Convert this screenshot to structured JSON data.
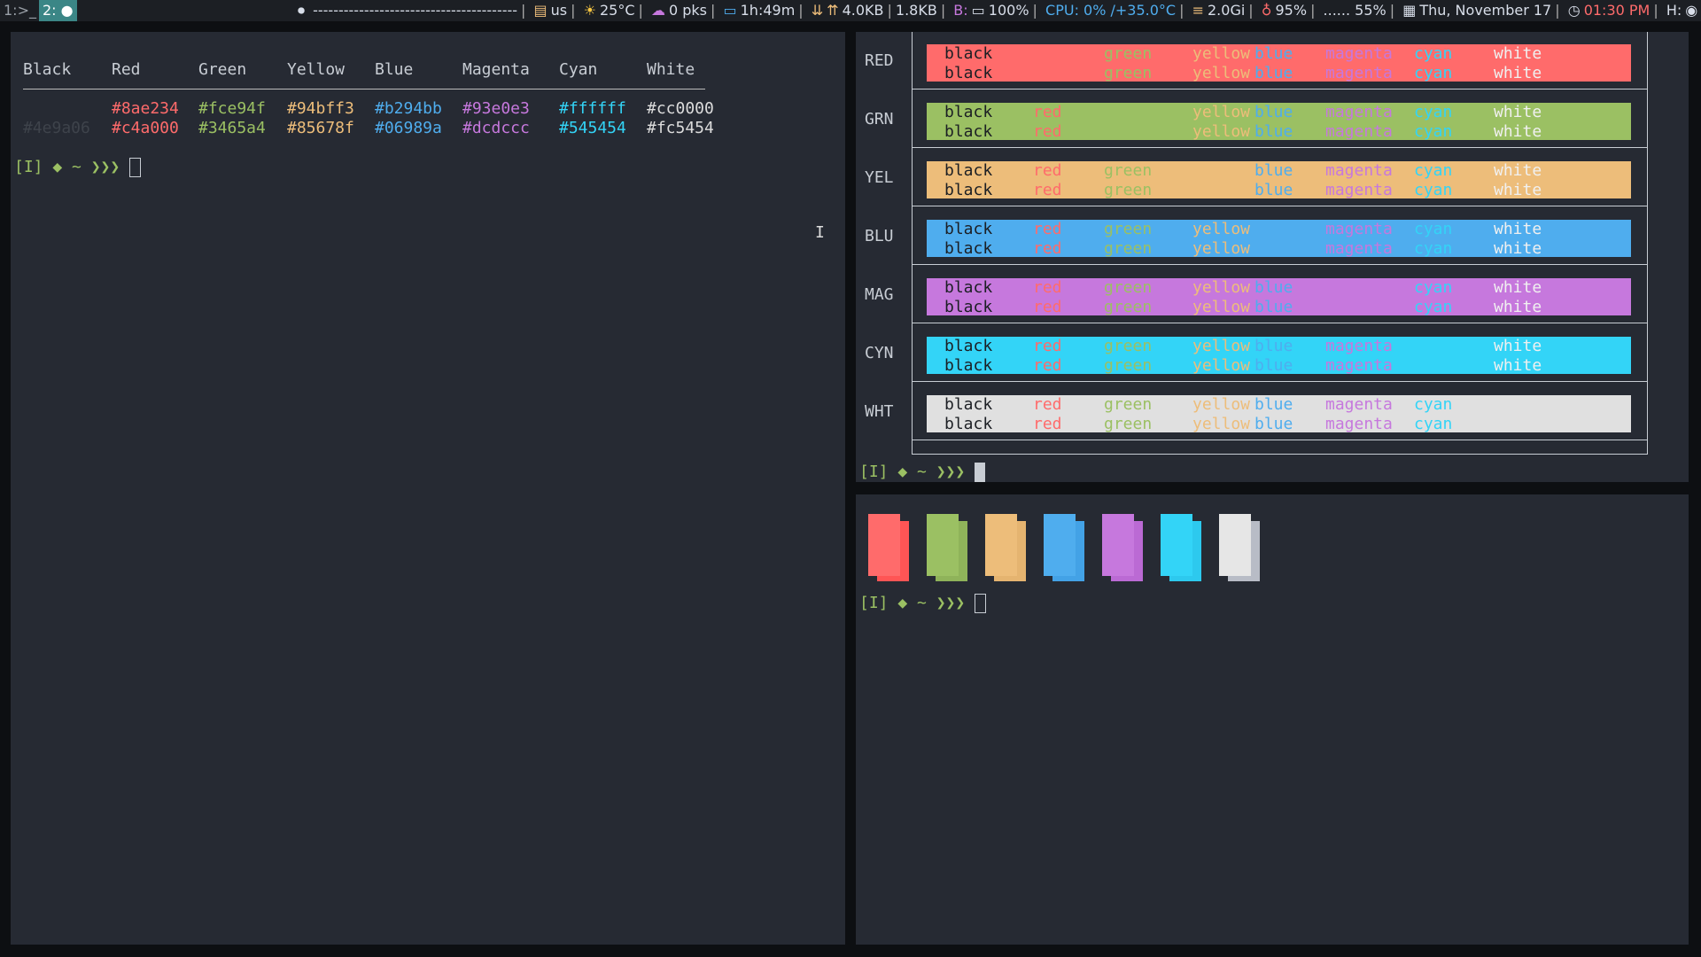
{
  "topbar": {
    "workspace1": "1:>_",
    "workspace2": "2:",
    "title_dashes": "----------------------------------------",
    "keyboard": "us",
    "weather": "25°C",
    "updates": "0 pks",
    "uptime": "1h:49m",
    "net_down": "4.0KB",
    "net_up": "1.8KB",
    "battery_label": "B:",
    "battery": "100%",
    "cpu": "CPU: 0% /+35.0°C",
    "memory": "2.0Gi",
    "brightness": "95%",
    "volume": "...... 55%",
    "date": "Thu, November 17",
    "time": "01:30 PM",
    "host": "H:"
  },
  "left_terminal": {
    "headers": [
      "Black",
      "Red",
      "Green",
      "Yellow",
      "Blue",
      "Magenta",
      "Cyan",
      "White"
    ],
    "row1": [
      "",
      "#8ae234",
      "#fce94f",
      "#94bff3",
      "#b294bb",
      "#93e0e3",
      "#ffffff",
      "#cc0000"
    ],
    "row2": [
      "#4e9a06",
      "#c4a000",
      "#3465a4",
      "#85678f",
      "#06989a",
      "#dcdccc",
      "#545454",
      "#fc5454"
    ],
    "prompt": "[I] ◆ ~ ❯❯❯"
  },
  "right_top": {
    "rows": [
      {
        "label": "RED",
        "bg": "#ff6b6b"
      },
      {
        "label": "GRN",
        "bg": "#9bc063"
      },
      {
        "label": "YEL",
        "bg": "#edbd7a"
      },
      {
        "label": "BLU",
        "bg": "#4fadee"
      },
      {
        "label": "MAG",
        "bg": "#c678dd"
      },
      {
        "label": "CYN",
        "bg": "#33d4f7"
      },
      {
        "label": "WHT",
        "bg": "#e0e0e0"
      }
    ],
    "words": [
      "black",
      "red",
      "green",
      "yellow",
      "blue",
      "magenta",
      "cyan",
      "white"
    ],
    "prompt": "[I] ◆ ~ ❯❯❯"
  },
  "right_bottom": {
    "prompt": "[I] ◆ ~ ❯❯❯"
  },
  "colors": {
    "red": "#ff6b6b",
    "green": "#9bc063",
    "yellow": "#edbd7a",
    "blue": "#4fadee",
    "magenta": "#c678dd",
    "cyan": "#33d4f7",
    "white": "#dcdcdc",
    "black": "#1c1f24"
  }
}
